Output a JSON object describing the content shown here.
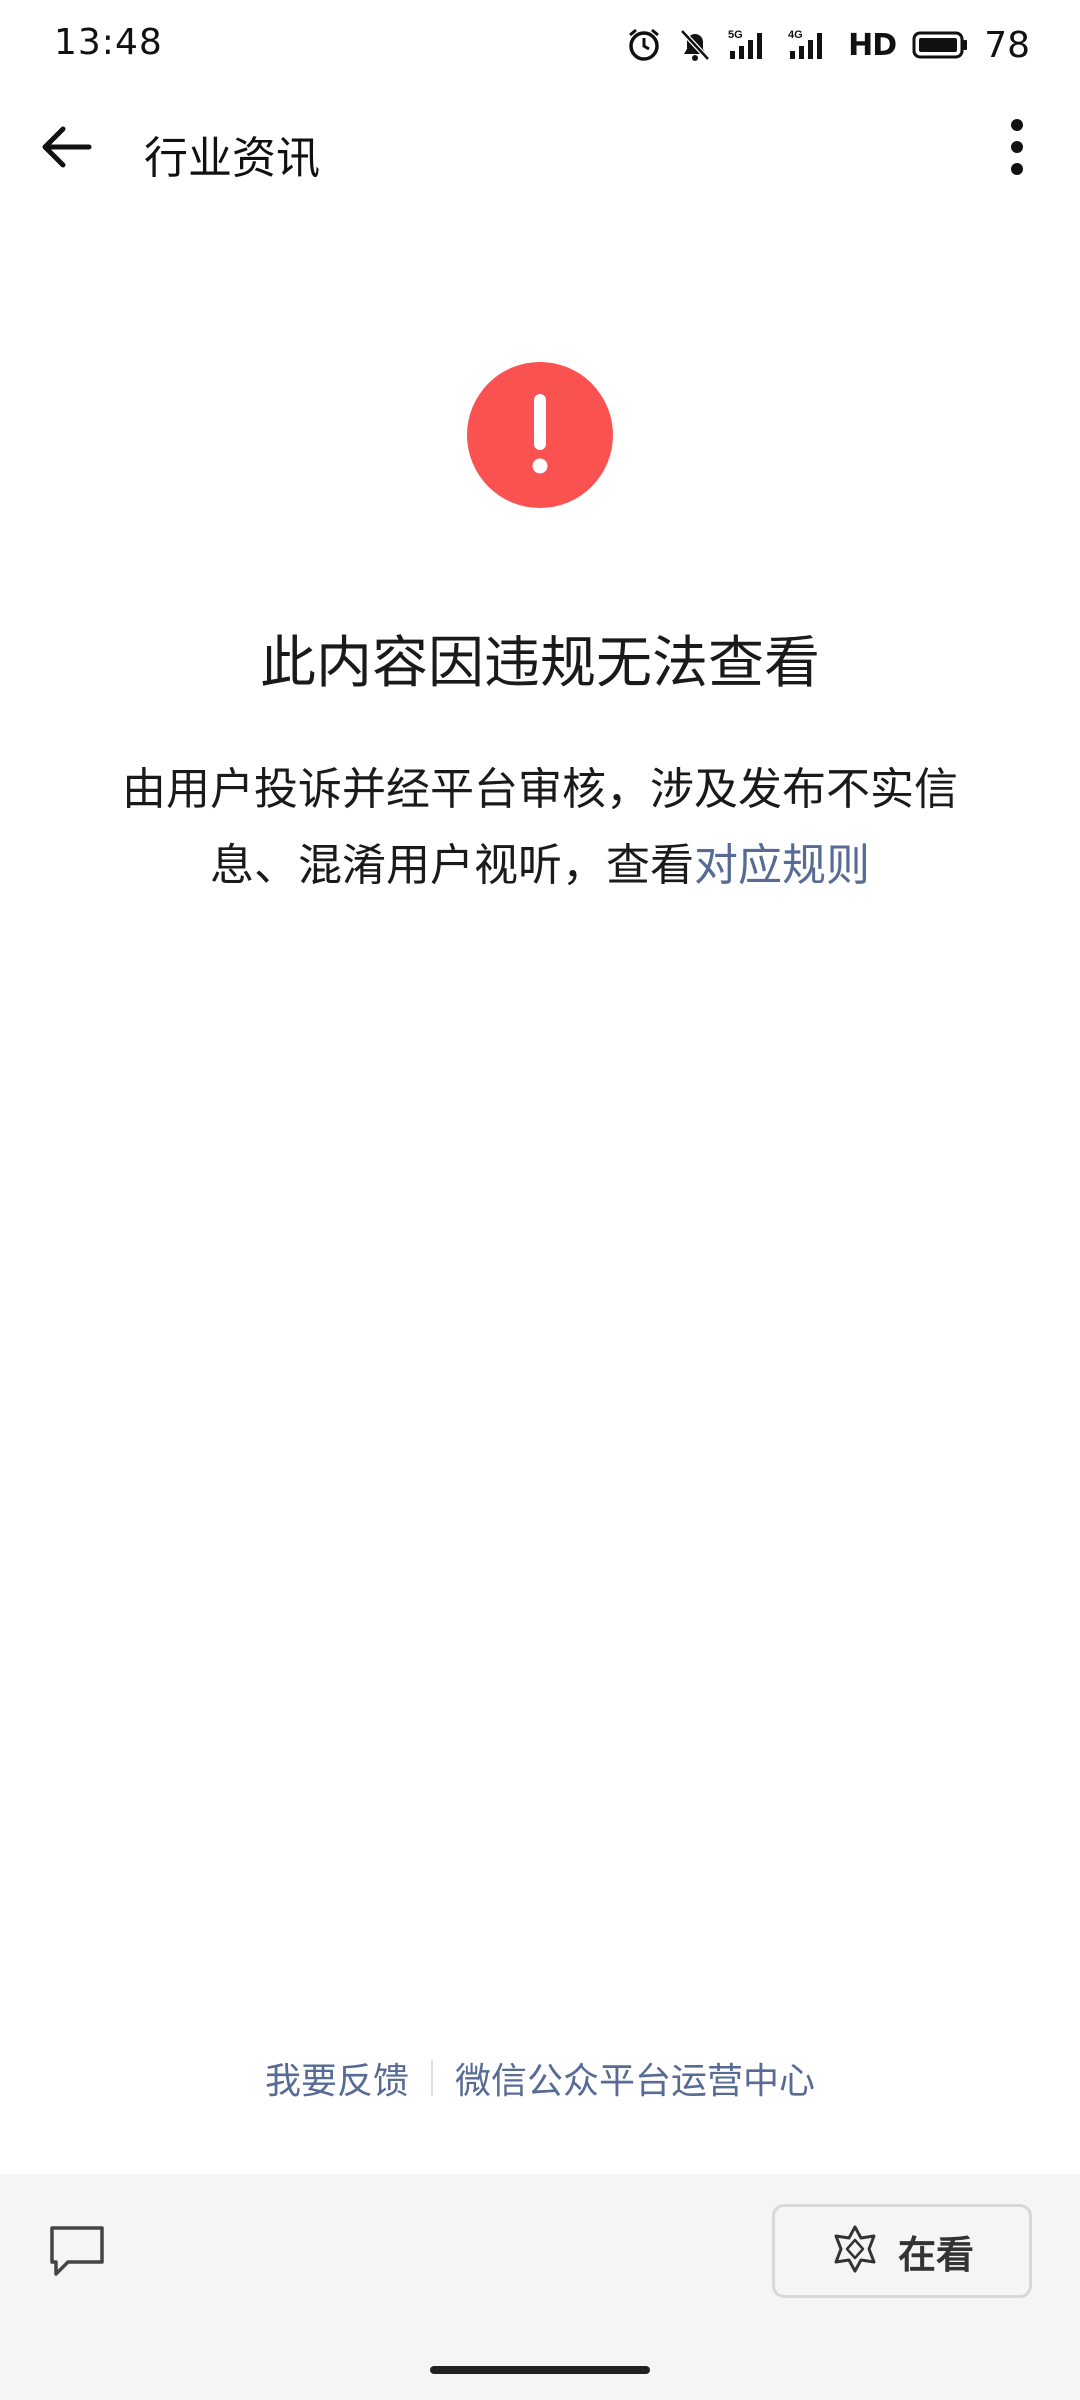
{
  "status_bar": {
    "time": "13:48",
    "hd_label": "HD",
    "battery_percent": "78",
    "icons": [
      "alarm-icon",
      "silent-bell-icon",
      "signal-5g-icon",
      "signal-4g-icon",
      "battery-icon"
    ]
  },
  "nav": {
    "title": "行业资讯",
    "back_icon": "back-arrow-icon",
    "more_icon": "more-vertical-icon"
  },
  "notice": {
    "icon": "exclamation-icon",
    "icon_color": "#fa5151",
    "title": "此内容因违规无法查看",
    "description": "由用户投诉并经平台审核，涉及发布不实信息、混淆用户视听，查看",
    "rule_link": "对应规则",
    "link_color": "#576b95"
  },
  "footer": {
    "feedback_link": "我要反馈",
    "platform_link": "微信公众平台运营中心"
  },
  "toolbar": {
    "comment_icon": "comment-icon",
    "watching_icon": "watching-star-icon",
    "watching_label": "在看"
  }
}
